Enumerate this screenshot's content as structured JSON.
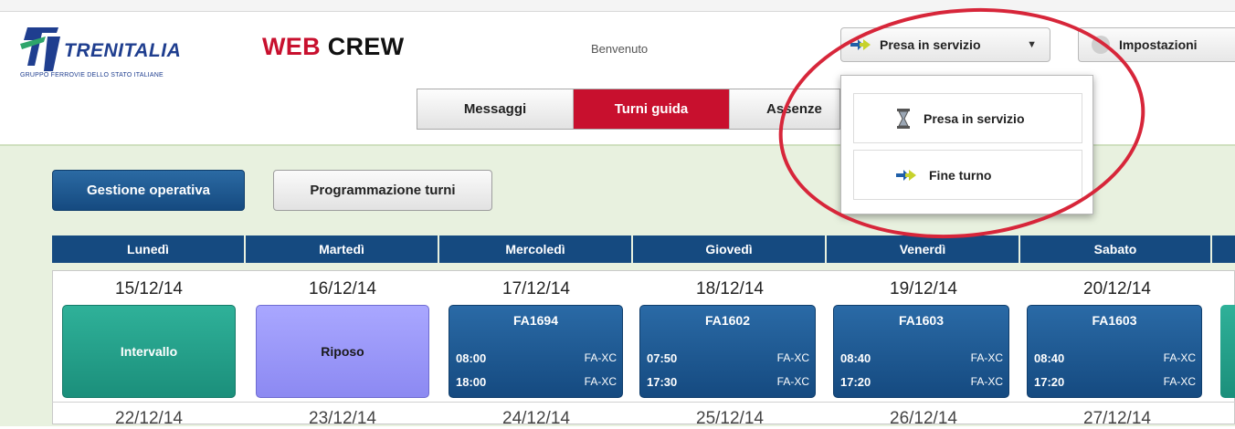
{
  "header": {
    "logo_name": "TRENITALIA",
    "logo_subtitle": "GRUPPO FERROVIE DELLO STATO ITALIANE",
    "app_title_red": "WEB",
    "app_title_dark": " CREW",
    "welcome": "Benvenuto",
    "presa_button": "Presa in servizio",
    "settings_button": "Impostazioni"
  },
  "tabs": [
    "Messaggi",
    "Turni guida",
    "Assenze"
  ],
  "dropdown": {
    "items": [
      {
        "label": "Presa in servizio",
        "icon": "hourglass-icon"
      },
      {
        "label": "Fine turno",
        "icon": "arrow-icon"
      }
    ]
  },
  "toolbar": {
    "gestione": "Gestione operativa",
    "programmazione": "Programmazione turni"
  },
  "calendar": {
    "days": [
      "Lunedì",
      "Martedì",
      "Mercoledì",
      "Giovedì",
      "Venerdì",
      "Sabato"
    ],
    "dates": [
      "15/12/14",
      "16/12/14",
      "17/12/14",
      "18/12/14",
      "19/12/14",
      "20/12/14"
    ],
    "next_dates": [
      "22/12/14",
      "23/12/14",
      "24/12/14",
      "25/12/14",
      "26/12/14",
      "27/12/14"
    ],
    "cards": [
      {
        "type": "teal",
        "label": "Intervallo"
      },
      {
        "type": "violet",
        "label": "Riposo"
      },
      {
        "type": "blue",
        "code": "FA1694",
        "start": "08:00",
        "end": "18:00",
        "station_start": "FA-XC",
        "station_end": "FA-XC"
      },
      {
        "type": "blue",
        "code": "FA1602",
        "start": "07:50",
        "end": "17:30",
        "station_start": "FA-XC",
        "station_end": "FA-XC"
      },
      {
        "type": "blue",
        "code": "FA1603",
        "start": "08:40",
        "end": "17:20",
        "station_start": "FA-XC",
        "station_end": "FA-XC"
      },
      {
        "type": "blue",
        "code": "FA1603",
        "start": "08:40",
        "end": "17:20",
        "station_start": "FA-XC",
        "station_end": "FA-XC"
      }
    ]
  },
  "colors": {
    "brand_red": "#c8102e",
    "brand_blue": "#154a80",
    "highlight_ring": "#d7263a"
  }
}
